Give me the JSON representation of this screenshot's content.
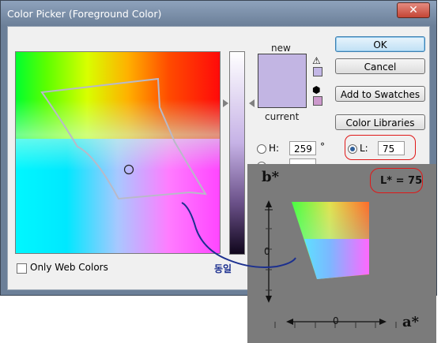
{
  "window": {
    "title": "Color Picker (Foreground Color)",
    "close_glyph": "✕"
  },
  "swatches": {
    "new_label": "new",
    "current_label": "current",
    "new_color": "#c2b5e3",
    "current_color": "#c2b5e3",
    "gamut_warning_color": "#c3b7e6",
    "websafe_color": "#cc99cc",
    "warning_icon": "⚠",
    "cube_icon": "⬢"
  },
  "buttons": {
    "ok": "OK",
    "cancel": "Cancel",
    "add_to_swatches": "Add to Swatches",
    "color_libraries": "Color Libraries"
  },
  "fields": {
    "h_label": "H:",
    "h_value": "259",
    "h_unit": "°",
    "l_label": "L:",
    "l_value": "75"
  },
  "bottom": {
    "only_web_colors": "Only Web Colors",
    "korean_note": "동일"
  },
  "inset": {
    "b_axis": "b*",
    "a_axis": "a*",
    "l_note": "L* = 75",
    "zero_b": "0",
    "zero_a": "0"
  },
  "colors": {
    "accent_red": "#e01818",
    "annotation_blue": "#1b2f8f"
  }
}
